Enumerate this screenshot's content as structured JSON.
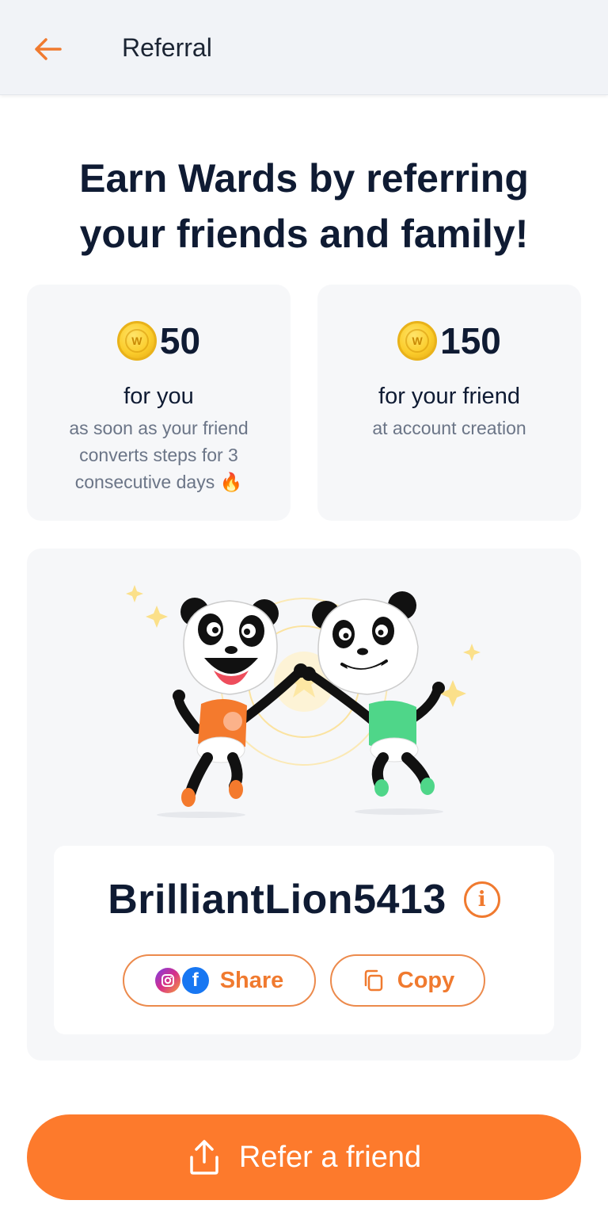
{
  "appbar": {
    "title": "Referral",
    "back_icon": "arrow-left-icon",
    "accent": "#f07a2f"
  },
  "headline": "Earn Wards by referring your friends and family!",
  "rewards": [
    {
      "coin_letter": "W",
      "amount": "50",
      "label": "for you",
      "description": "as soon as your friend converts steps for 3 consecutive days 🔥"
    },
    {
      "coin_letter": "W",
      "amount": "150",
      "label": "for your friend",
      "description": "at account creation"
    }
  ],
  "referral": {
    "code": "BrilliantLion5413",
    "info_icon": "info-icon",
    "share_label": "Share",
    "copy_label": "Copy"
  },
  "cta": {
    "label": "Refer a friend",
    "icon": "share-upload-icon",
    "color": "#fd7a2c"
  }
}
